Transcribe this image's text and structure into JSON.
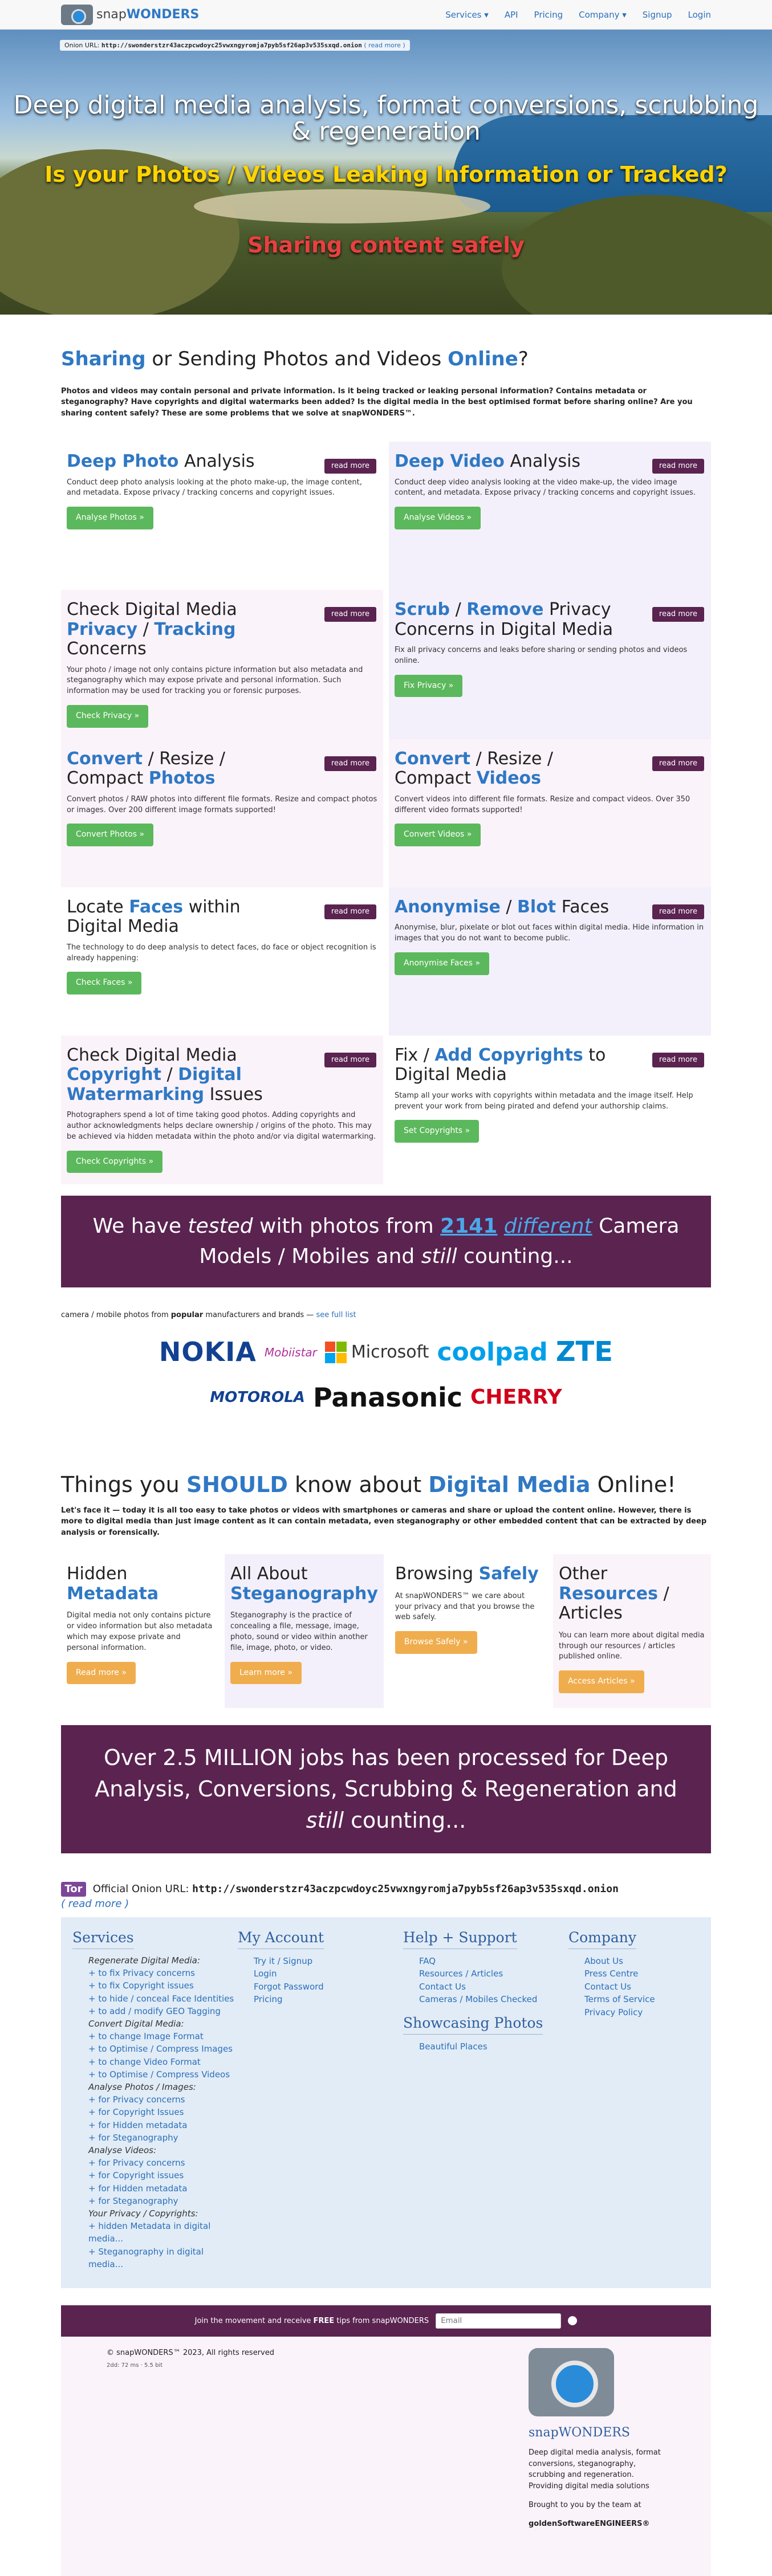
{
  "nav": {
    "logo_prefix": "snap",
    "logo_brand": "WONDERS",
    "links": [
      "Services ▾",
      "API",
      "Pricing",
      "Company ▾",
      "Signup",
      "Login"
    ]
  },
  "hero": {
    "onion_label": "Onion URL:",
    "onion_url": "http://swonderstzr43aczpcwdoyc25vwxngyromja7pyb5sf26ap3v535sxqd.onion",
    "onion_more": "( read more )",
    "title": "Deep digital media analysis, format conversions, scrubbing & regeneration",
    "question": "Is your Photos / Videos Leaking Information or Tracked?",
    "tagline": "Sharing content safely"
  },
  "intro": {
    "h_word1": "Sharing",
    "h_mid": " or Sending Photos and Videos ",
    "h_word2": "Online",
    "h_end": "?",
    "text": "Photos and videos may contain personal and private information. Is it being tracked or leaking personal information? Contains metadata or steganography? Have copyrights and digital watermarks been added? Is the digital media in the best optimised format before sharing online? Are you sharing content safely? These are some problems that we solve at snapWONDERS™."
  },
  "read_more": "read more",
  "cards": [
    {
      "pre": "",
      "hl1": "Deep Photo",
      "mid": " Analysis",
      "hl2": "",
      "post": "",
      "text": "Conduct deep photo analysis looking at the photo make-up, the image content, and metadata. Expose privacy / tracking concerns and copyright issues.",
      "button": "Analyse Photos »"
    },
    {
      "pre": "",
      "hl1": "Deep Video",
      "mid": " Analysis",
      "hl2": "",
      "post": "",
      "text": "Conduct deep video analysis looking at the video make-up, the video image content, and metadata. Expose privacy / tracking concerns and copyright issues.",
      "button": "Analyse Videos »"
    },
    {
      "pre": "Check Digital Media ",
      "hl1": "Privacy",
      "mid": " / ",
      "hl2": "Tracking",
      "post": " Concerns",
      "text": "Your photo / image not only contains picture information but also metadata and steganography which may expose private and personal information. Such information may be used for tracking you or forensic purposes.",
      "button": "Check Privacy »"
    },
    {
      "pre": "",
      "hl1": "Scrub",
      "mid": " / ",
      "hl2": "Remove",
      "post": " Privacy Concerns in Digital Media",
      "text": "Fix all privacy concerns and leaks before sharing or sending photos and videos online.",
      "button": "Fix Privacy »"
    },
    {
      "pre": "",
      "hl1": "Convert",
      "mid": " / Resize / Compact ",
      "hl2": "Photos",
      "post": "",
      "text": "Convert photos / RAW photos into different file formats. Resize and compact photos or images. Over 200 different image formats supported!",
      "button": "Convert Photos »"
    },
    {
      "pre": "",
      "hl1": "Convert",
      "mid": " / Resize / Compact ",
      "hl2": "Videos",
      "post": "",
      "text": "Convert videos into different file formats. Resize and compact videos. Over 350 different video formats supported!",
      "button": "Convert Videos »"
    },
    {
      "pre": "Locate ",
      "hl1": "Faces",
      "mid": " within Digital Media",
      "hl2": "",
      "post": "",
      "text": "The technology to do deep analysis to detect faces, do face or object recognition is already happening:",
      "button": "Check Faces »"
    },
    {
      "pre": "",
      "hl1": "Anonymise",
      "mid": " / ",
      "hl2": "Blot",
      "post": " Faces",
      "text": "Anonymise, blur, pixelate or blot out faces within digital media. Hide information in images that you do not want to become public.",
      "button": "Anonymise Faces »"
    },
    {
      "pre": "Check Digital Media ",
      "hl1": "Copyright",
      "mid": " / ",
      "hl2": "Digital Watermarking",
      "post": " Issues",
      "text": "Photographers spend a lot of time taking good photos. Adding copyrights and author acknowledgments helps declare ownership / origins of the photo. This may be achieved via hidden metadata within the photo and/or via digital watermarking.",
      "button": "Check Copyrights »"
    },
    {
      "pre": "Fix / ",
      "hl1": "Add Copyrights",
      "mid": " to Digital Media",
      "hl2": "",
      "post": "",
      "text": "Stamp all your works with copyrights within metadata and the image itself. Help prevent your work from being pirated and defend your authorship claims.",
      "button": "Set Copyrights »"
    }
  ],
  "tested_banner": {
    "t1": "We have ",
    "t2": "tested",
    "t3": " with photos from ",
    "num": "2141",
    "t4": " ",
    "diff": "different",
    "t5": " Camera Models / Mobiles and ",
    "still": "still",
    "t6": " counting..."
  },
  "brands": {
    "intro_pre": "camera / mobile photos from ",
    "intro_bold": "popular",
    "intro_post": " manufacturers and brands — ",
    "see_full": "see full list",
    "names": [
      "NOKIA",
      "Mobiistar",
      "Microsoft",
      "coolpad",
      "ZTE",
      "MOTOROLA",
      "Panasonic",
      "CHERRY"
    ]
  },
  "things": {
    "h1": "Things you ",
    "h_should": "SHOULD",
    "h2": " know about ",
    "h_dm": "Digital Media",
    "h3": " Online!",
    "lead": "Let's face it — today it is all too easy to take photos or videos with smartphones or cameras and share or upload the content online. However, there is more to digital media than just image content as it can contain metadata, even steganography or other embedded content that can be extracted by deep analysis or forensically.",
    "cards": [
      {
        "pre": "Hidden ",
        "hl": "Metadata",
        "post": "",
        "text": "Digital media not only contains picture or video information but also metadata which may expose private and personal information.",
        "button": "Read more »"
      },
      {
        "pre": "All About ",
        "hl": "Steganography",
        "post": "",
        "text": "Steganography is the practice of concealing a file, message, image, photo, sound or video within another file, image, photo, or video.",
        "button": "Learn more »"
      },
      {
        "pre": "Browsing ",
        "hl": "Safely",
        "post": "",
        "text": "At snapWONDERS™ we care about your privacy and that you browse the web safely.",
        "button": "Browse Safely »"
      },
      {
        "pre": "Other ",
        "hl": "Resources",
        "post": " / Articles",
        "text": "You can learn more about digital media through our resources / articles published online.",
        "button": "Access Articles »"
      }
    ]
  },
  "jobs_banner": {
    "t1": "Over 2.5 MILLION jobs has been processed for Deep Analysis, Conversions, Scrubbing & Regeneration and ",
    "still": "still",
    "t2": " counting..."
  },
  "onion_footer": {
    "tor": "Tor",
    "label": " Official Onion URL: ",
    "url": "http://swonderstzr43aczpcwdoyc25vwxngyromja7pyb5sf26ap3v535sxqd.onion",
    "more": "( read more )"
  },
  "footer": {
    "services_title": "Services",
    "services": [
      {
        "type": "cat",
        "text": "Regenerate Digital Media:"
      },
      {
        "type": "link",
        "text": "+ to fix Privacy concerns"
      },
      {
        "type": "link",
        "text": "+ to fix Copyright issues"
      },
      {
        "type": "link",
        "text": "+ to hide / conceal Face Identities"
      },
      {
        "type": "link",
        "text": "+ to add / modify GEO Tagging"
      },
      {
        "type": "cat",
        "text": "Convert Digital Media:"
      },
      {
        "type": "link",
        "text": "+ to change Image Format"
      },
      {
        "type": "link",
        "text": "+ to Optimise / Compress Images"
      },
      {
        "type": "link",
        "text": "+ to change Video Format"
      },
      {
        "type": "link",
        "text": "+ to Optimise / Compress Videos"
      },
      {
        "type": "cat",
        "text": "Analyse Photos / Images:"
      },
      {
        "type": "link",
        "text": "+ for Privacy concerns"
      },
      {
        "type": "link",
        "text": "+ for Copyright Issues"
      },
      {
        "type": "link",
        "text": "+ for Hidden metadata"
      },
      {
        "type": "link",
        "text": "+ for Steganography"
      },
      {
        "type": "cat",
        "text": "Analyse Videos:"
      },
      {
        "type": "link",
        "text": "+ for Privacy concerns"
      },
      {
        "type": "link",
        "text": "+ for Copyright issues"
      },
      {
        "type": "link",
        "text": "+ for Hidden metadata"
      },
      {
        "type": "link",
        "text": "+ for Steganography"
      },
      {
        "type": "cat",
        "text": "Your Privacy / Copyrights:"
      },
      {
        "type": "link",
        "text": "+ hidden Metadata in digital media..."
      },
      {
        "type": "link",
        "text": "+ Steganography in digital media..."
      }
    ],
    "account_title": "My Account",
    "account": [
      "Try it / Signup",
      "Login",
      "Forgot Password",
      "Pricing"
    ],
    "help_title": "Help + Support",
    "help": [
      "FAQ",
      "Resources / Articles",
      "Contact Us",
      "Cameras / Mobiles Checked"
    ],
    "showcase_title": "Showcasing Photos",
    "showcase": [
      "Beautiful Places"
    ],
    "company_title": "Company",
    "company": [
      "About Us",
      "Press Centre",
      "Contact Us",
      "Terms of Service",
      "Privacy Policy"
    ]
  },
  "newsletter": {
    "pre": "Join the movement and receive ",
    "free": "FREE",
    "post": " tips from snapWONDERS",
    "placeholder": "Email"
  },
  "bottom": {
    "copyright": "© snapWONDERS™ 2023, All rights reserved",
    "tiny": "2dd: 72 ms · 5.5 bit",
    "brand_prefix": "snap",
    "brand_main": "WONDERS",
    "desc": "Deep digital media analysis, format conversions, steganography, scrubbing and regeneration. Providing digital media solutions",
    "by": "Brought to you by the team at",
    "team": "goldenSoftwareENGINEERS®"
  },
  "colors": {
    "accent": "#2f78c4",
    "purple": "#5a2350",
    "green": "#5cb85c",
    "orange": "#f0ad4e"
  }
}
